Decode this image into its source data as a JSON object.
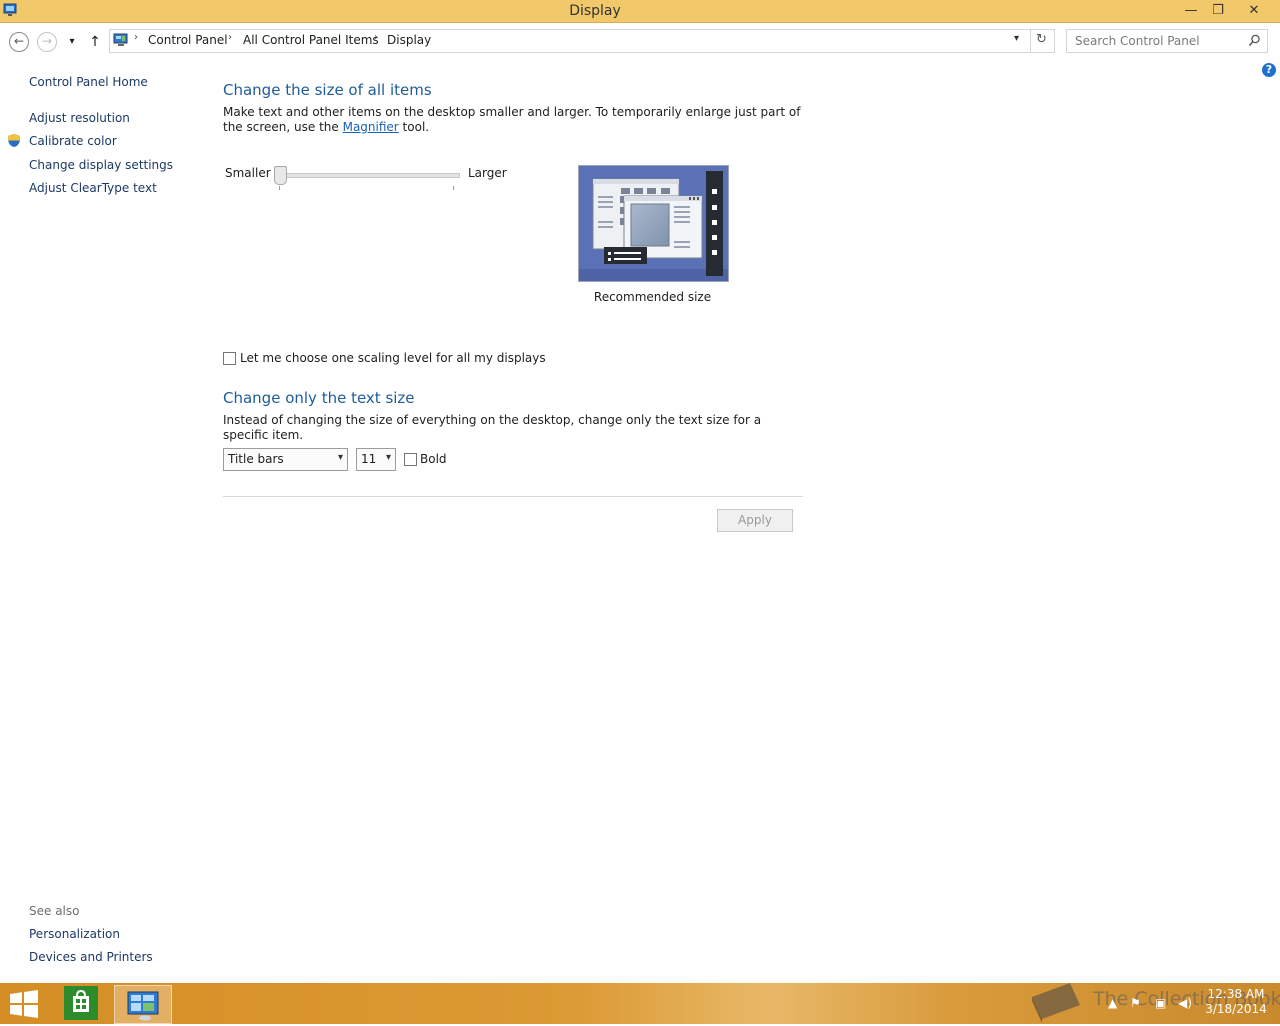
{
  "window": {
    "title": "Display",
    "minimize": "—",
    "maximize": "❐",
    "close": "✕"
  },
  "nav": {
    "back": "←",
    "forward": "→",
    "recent": "▾",
    "up": "↑",
    "refresh": "↻",
    "dropdown": "▾",
    "breadcrumbs": [
      "Control Panel",
      "All Control Panel Items",
      "Display"
    ],
    "search_placeholder": "Search Control Panel"
  },
  "sidebar": {
    "home": "Control Panel Home",
    "items": [
      {
        "label": "Adjust resolution",
        "icon": ""
      },
      {
        "label": "Calibrate color",
        "icon": "shield-icon"
      },
      {
        "label": "Change display settings",
        "icon": ""
      },
      {
        "label": "Adjust ClearType text",
        "icon": ""
      }
    ],
    "see_also_header": "See also",
    "see_also": [
      "Personalization",
      "Devices and Printers"
    ]
  },
  "main": {
    "section1_title": "Change the size of all items",
    "section1_text_before": "Make text and other items on the desktop smaller and larger. To temporarily enlarge just part of the screen, use the ",
    "section1_link": "Magnifier",
    "section1_text_after": " tool.",
    "slider_min_label": "Smaller",
    "slider_max_label": "Larger",
    "slider_level": 0,
    "preview_caption": "Recommended size",
    "scaling_checkbox_label": "Let me choose one scaling level for all my displays",
    "scaling_checked": false,
    "section2_title": "Change only the text size",
    "section2_text": "Instead of changing the size of everything on the desktop, change only the text size for a specific item.",
    "item_select_value": "Title bars",
    "size_select_value": "11",
    "bold_label": "Bold",
    "bold_checked": false,
    "apply_label": "Apply",
    "help": "?"
  },
  "taskbar": {
    "watermark": "The Collection Book",
    "time": "12:38 AM",
    "date": "3/18/2014"
  },
  "colors": {
    "titlebar": "#f2c96a",
    "link": "#1c3a66",
    "heading": "#1e5c9b",
    "taskbar": "#d58e25"
  }
}
